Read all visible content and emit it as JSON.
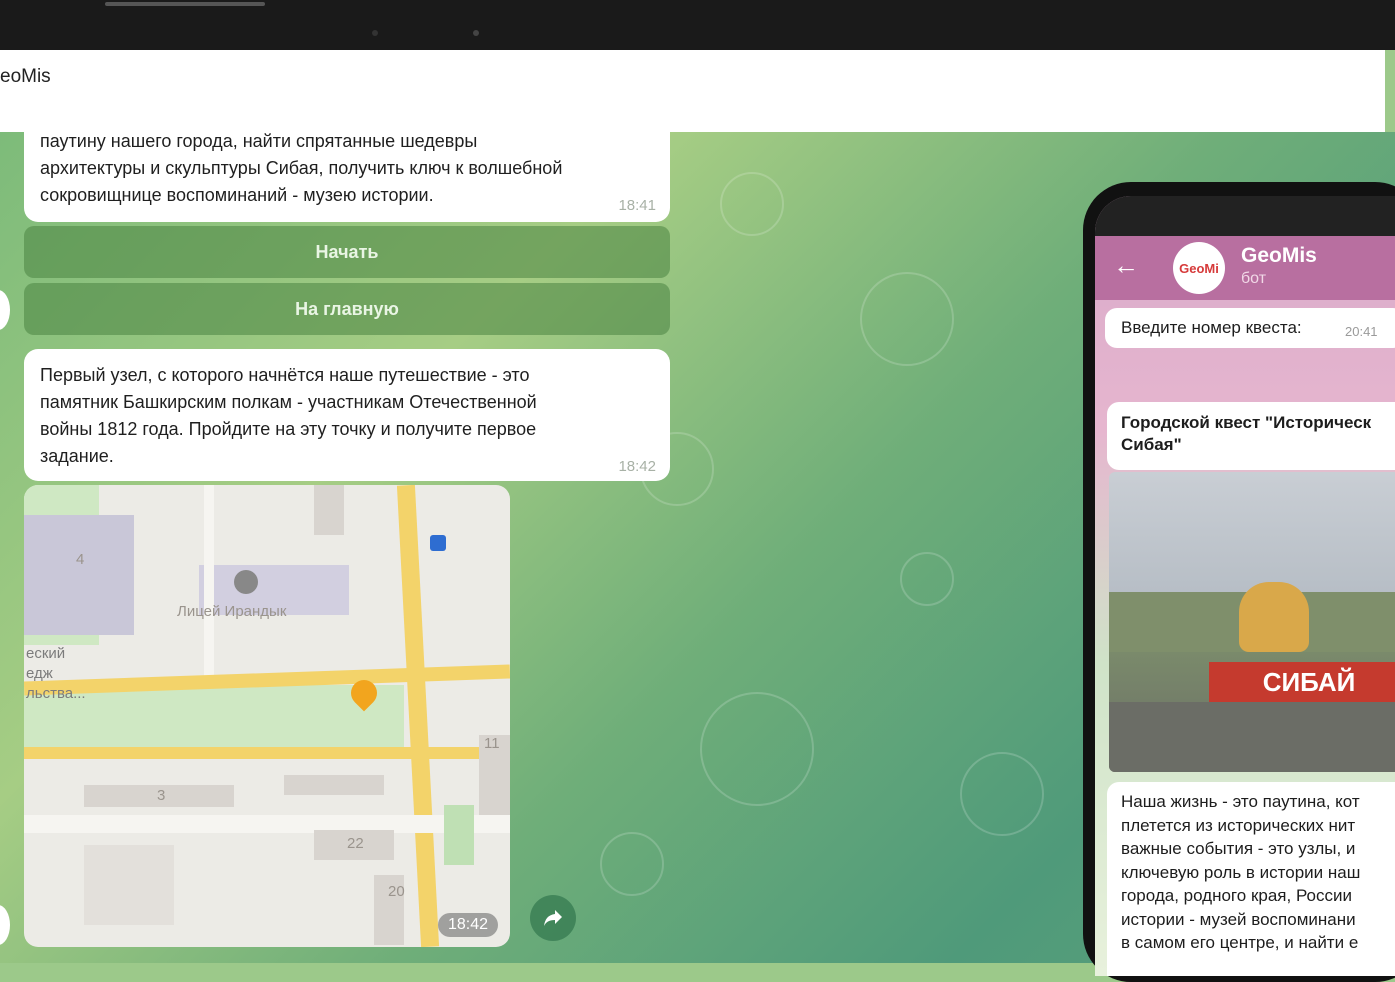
{
  "header": {
    "title": "eoMis"
  },
  "messages": {
    "m1": {
      "lines": [
        "паутину нашего города, найти спрятанные шедевры",
        "архитектуры и скульптуры Сибая, получить ключ к волшебной",
        "сокровищнице воспоминаний - музею истории."
      ],
      "time": "18:41"
    },
    "buttons": {
      "start": "Начать",
      "home": "На главную"
    },
    "m2": {
      "lines": [
        "Первый узел, с которого начнётся наше путешествие - это",
        "памятник Башкирским полкам - участникам Отечественной",
        "войны 1812 года. Пройдите на эту точку и получите первое",
        "задание."
      ],
      "time": "18:42"
    },
    "map": {
      "time": "18:42",
      "labels": {
        "school": "Лицей Ирандык",
        "college_1": "еский",
        "college_2": "едж",
        "college_3": "льства...",
        "n4": "4",
        "n3": "3",
        "n22": "22",
        "n20": "20",
        "n11": "11"
      }
    }
  },
  "phone": {
    "bot_name": "GeoMis",
    "bot_sub": "бот",
    "avatar_text": "GeoMi",
    "msg1": {
      "text": "Введите номер квеста:",
      "time": "20:41"
    },
    "quest_title_1": "Городской квест \"Историческ",
    "quest_title_2": "Сибая\"",
    "photo_sign": "СИБАЙ",
    "desc": [
      "Наша жизнь - это паутина, кот",
      "плетется из исторических нит",
      "важные события - это узлы, и",
      "ключевую роль в истории наш",
      "города, родного края, России",
      "истории - музей воспоминани",
      "в самом его центре, и найти е"
    ]
  }
}
